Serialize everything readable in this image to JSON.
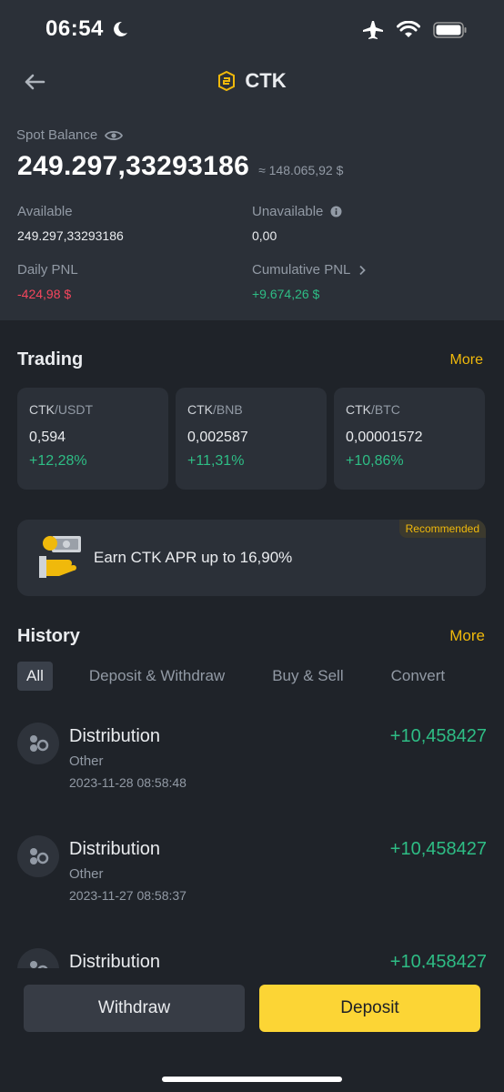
{
  "status_bar": {
    "time": "06:54"
  },
  "header": {
    "title": "CTK"
  },
  "balance": {
    "label": "Spot Balance",
    "amount": "249.297,33293186",
    "fiat": "≈ 148.065,92 $",
    "available_label": "Available",
    "available_value": "249.297,33293186",
    "unavailable_label": "Unavailable",
    "unavailable_value": "0,00",
    "daily_pnl_label": "Daily PNL",
    "daily_pnl_value": "-424,98 $",
    "cumulative_pnl_label": "Cumulative PNL",
    "cumulative_pnl_value": "+9.674,26 $"
  },
  "trading": {
    "title": "Trading",
    "more": "More",
    "pairs": [
      {
        "base": "CTK",
        "quote": "/USDT",
        "price": "0,594",
        "change": "+12,28%"
      },
      {
        "base": "CTK",
        "quote": "/BNB",
        "price": "0,002587",
        "change": "+11,31%"
      },
      {
        "base": "CTK",
        "quote": "/BTC",
        "price": "0,00001572",
        "change": "+10,86%"
      }
    ]
  },
  "earn": {
    "badge": "Recommended",
    "text": "Earn CTK APR up to 16,90%"
  },
  "history": {
    "title": "History",
    "more": "More",
    "tabs": [
      "All",
      "Deposit & Withdraw",
      "Buy & Sell",
      "Convert"
    ],
    "items": [
      {
        "title": "Distribution",
        "type": "Other",
        "date": "2023-11-28 08:58:48",
        "amount": "+10,458427"
      },
      {
        "title": "Distribution",
        "type": "Other",
        "date": "2023-11-27 08:58:37",
        "amount": "+10,458427"
      },
      {
        "title": "Distribution",
        "type": "",
        "date": "",
        "amount": "+10,458427"
      }
    ]
  },
  "actions": {
    "withdraw": "Withdraw",
    "deposit": "Deposit"
  },
  "colors": {
    "accent": "#f0b90b",
    "positive": "#2ebd85",
    "negative": "#f6465d",
    "deposit_button": "#fcd535"
  }
}
